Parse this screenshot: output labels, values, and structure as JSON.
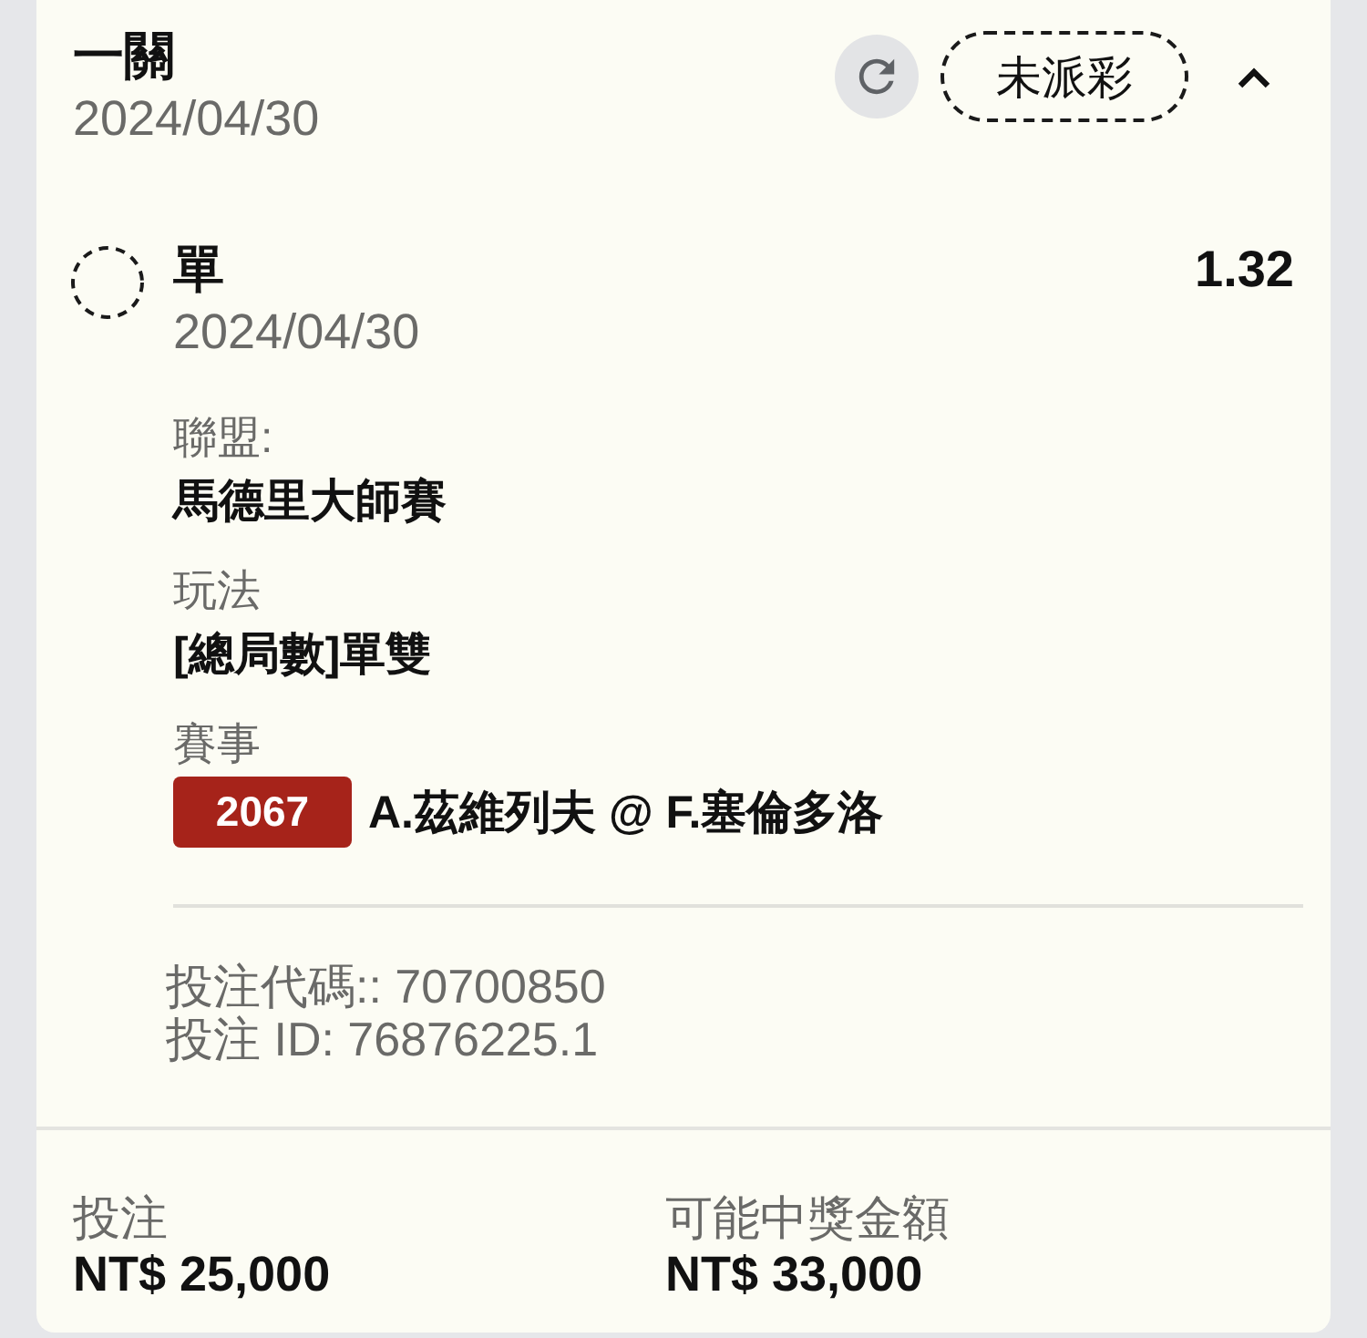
{
  "header": {
    "title": "一關",
    "date": "2024/04/30",
    "status": "未派彩",
    "expanded": true
  },
  "selection": {
    "name": "單",
    "date": "2024/04/30",
    "odds": "1.32"
  },
  "details": [
    {
      "label": "聯盟:",
      "value": "馬德里大師賽"
    },
    {
      "label": "玩法",
      "value": "[總局數]單雙"
    },
    {
      "label": "賽事",
      "badge": "2067",
      "value": "A.茲維列夫 @ F.塞倫多洛"
    }
  ],
  "codes": [
    "投注代碼:: 70700850",
    "投注 ID: 76876225.1"
  ],
  "footer": [
    {
      "label": "投注",
      "amount": "NT$ 25,000"
    },
    {
      "label": "可能中獎金額",
      "amount": "NT$ 33,000"
    }
  ]
}
